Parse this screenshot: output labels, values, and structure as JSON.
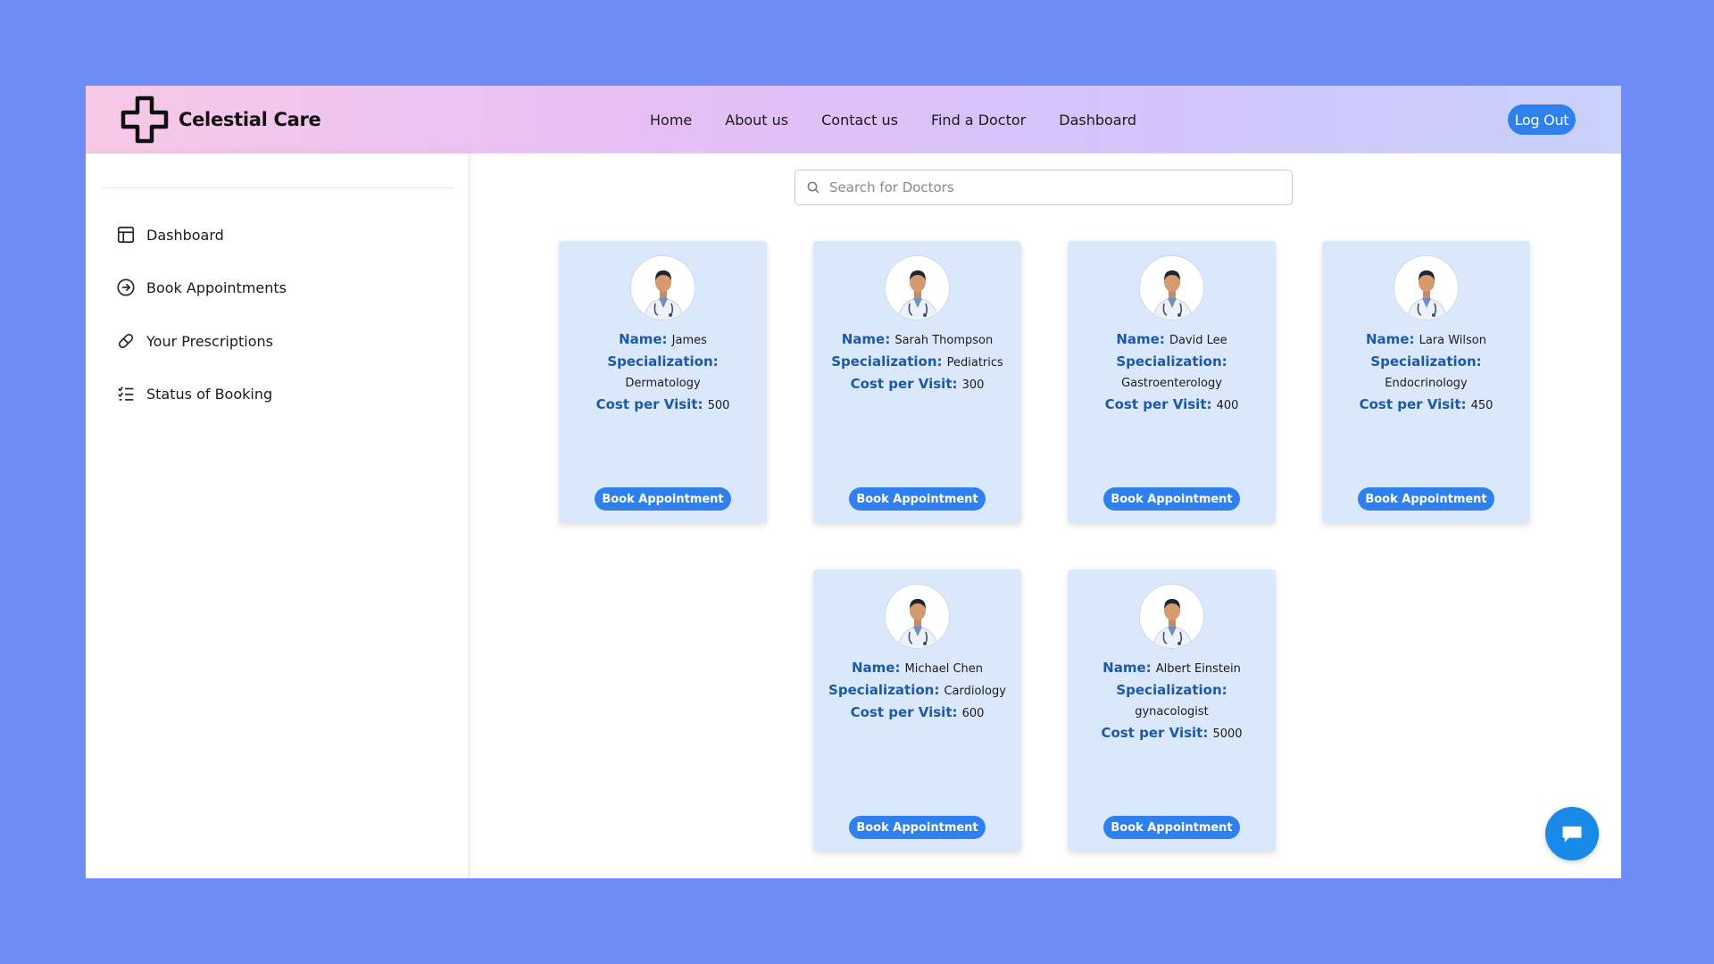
{
  "brand": {
    "name": "Celestial Care"
  },
  "nav": {
    "links": [
      "Home",
      "About us",
      "Contact us",
      "Find a Doctor",
      "Dashboard"
    ],
    "logout_label": "Log Out"
  },
  "sidebar": {
    "items": [
      {
        "label": "Dashboard",
        "icon": "layout-icon"
      },
      {
        "label": "Book Appointments",
        "icon": "arrow-circle-icon"
      },
      {
        "label": "Your Prescriptions",
        "icon": "pill-icon"
      },
      {
        "label": "Status of Booking",
        "icon": "checklist-icon"
      }
    ]
  },
  "search": {
    "placeholder": "Search for Doctors",
    "value": ""
  },
  "labels": {
    "name": "Name:",
    "specialization": "Specialization:",
    "cost": "Cost per Visit:",
    "book": "Book Appointment"
  },
  "doctors": [
    {
      "name": "James",
      "specialization": "Dermatology",
      "cost": "500"
    },
    {
      "name": "Sarah Thompson",
      "specialization": "Pediatrics",
      "cost": "300"
    },
    {
      "name": "David Lee",
      "specialization": "Gastroenterology",
      "cost": "400"
    },
    {
      "name": "Lara Wilson",
      "specialization": "Endocrinology",
      "cost": "450"
    },
    {
      "name": "Michael Chen",
      "specialization": "Cardiology",
      "cost": "600"
    },
    {
      "name": "Albert Einstein",
      "specialization": "gynacologist",
      "cost": "5000"
    }
  ],
  "colors": {
    "accent": "#2f80ed",
    "background": "#6c8bf5",
    "card": "#dbe8fb",
    "label": "#1c5aa8"
  }
}
